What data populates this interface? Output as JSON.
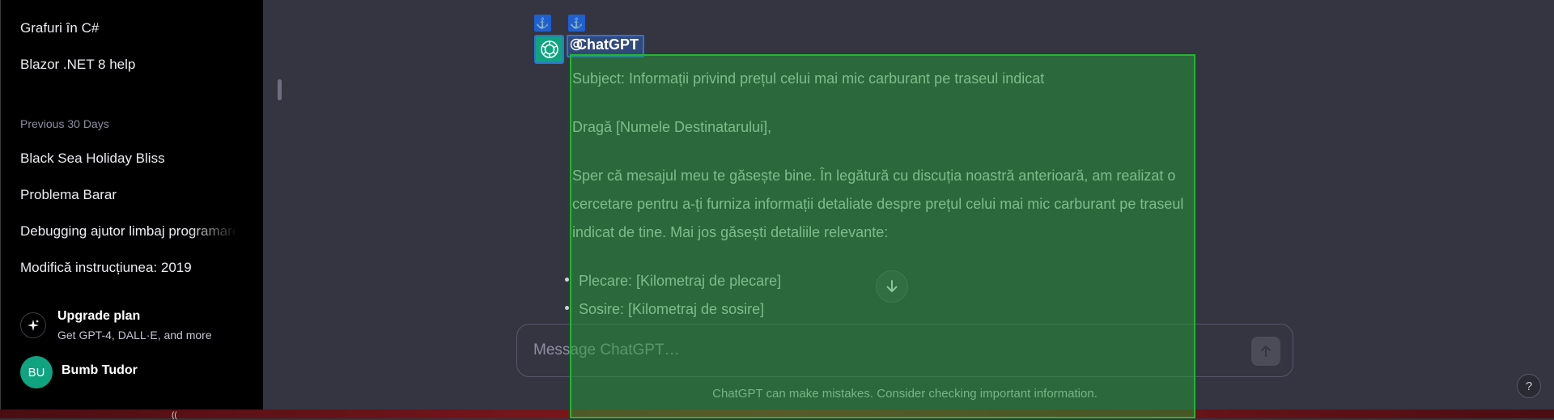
{
  "sidebar": {
    "recent_items": [
      {
        "label": "Grafuri în C#"
      },
      {
        "label": "Blazor .NET 8 help"
      }
    ],
    "section_label": "Previous 30 Days",
    "items": [
      {
        "label": "Black Sea Holiday Bliss"
      },
      {
        "label": "Problema Barar"
      },
      {
        "label": "Debugging ajutor limbaj programare"
      },
      {
        "label": "Modifică instrucțiunea: 2019"
      }
    ],
    "upgrade": {
      "title": "Upgrade plan",
      "subtitle": "Get GPT-4, DALL·E, and more"
    },
    "user": {
      "initials": "BU",
      "name": "Bumb Tudor"
    }
  },
  "conversation": {
    "author": "ChatGPT",
    "anchor_glyph": "⚓",
    "message": {
      "paragraphs": [
        "Subject: Informații privind prețul celui mai mic carburant pe traseul indicat",
        "Dragă [Numele Destinatarului],",
        "Sper că mesajul meu te găsește bine. În legătură cu discuția noastră anterioară, am realizat o cercetare pentru a-ți furniza informații detaliate despre prețul celui mai mic carburant pe traseul indicat de tine. Mai jos găsești detaliile relevante:"
      ],
      "bullets": [
        "Plecare: [Kilometraj de plecare]",
        "Sosire: [Kilometraj de sosire]"
      ]
    }
  },
  "composer": {
    "placeholder": "Message ChatGPT…"
  },
  "footer": {
    "disclaimer": "ChatGPT can make mistakes. Consider checking important information.",
    "help_label": "?"
  },
  "taskbar": {
    "glyph": "(( "
  },
  "colors": {
    "accent": "#10a37f",
    "overlay": "#22a034",
    "selection": "#2f6fe0"
  }
}
